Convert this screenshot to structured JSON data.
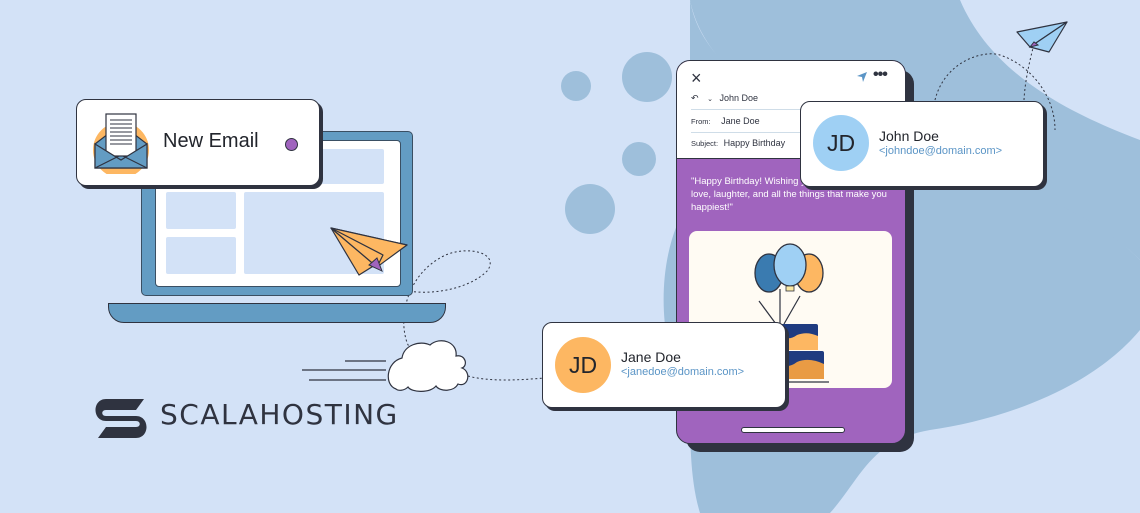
{
  "colors": {
    "background": "#d3e2f7",
    "blob": "#9ebfdb",
    "laptop": "#639cc3",
    "phone_body": "#a064be",
    "outline": "#2f3340",
    "accent_orange": "#fdb762",
    "accent_light_blue": "#9fd0f4",
    "email_link": "#5b95c6"
  },
  "new_email": {
    "label": "New Email",
    "icon": "envelope-letter-icon"
  },
  "phone": {
    "close_icon": "×",
    "more_icon": "•••",
    "to_name": "John Doe",
    "from_label": "From:",
    "from_value": "Jane Doe",
    "subject_label": "Subject:",
    "subject_value": "Happy Birthday",
    "message": "\"Happy Birthday! Wishing you a day filled with love, laughter, and all the things that make you happiest!\""
  },
  "contacts": {
    "recipient": {
      "initials": "JD",
      "name": "John Doe",
      "email": "<johndoe@domain.com>"
    },
    "sender": {
      "initials": "JD",
      "name": "Jane Doe",
      "email": "<janedoe@domain.com>"
    }
  },
  "brand": {
    "name": "SCALAHOSTING"
  }
}
